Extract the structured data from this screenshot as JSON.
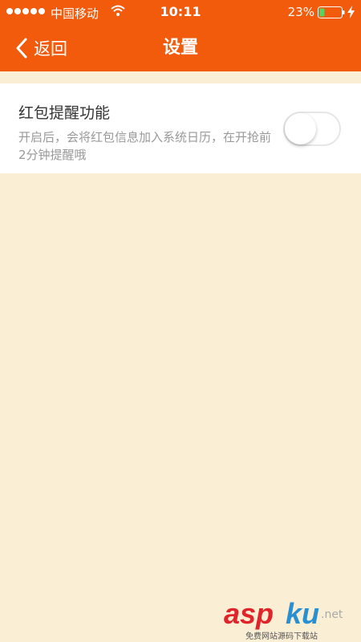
{
  "status_bar": {
    "carrier": "中国移动",
    "time": "10:11",
    "battery_percent": "23%",
    "battery_level": 0.23,
    "icons": [
      "signal-dots-icon",
      "wifi-icon",
      "battery-icon",
      "charging-icon"
    ]
  },
  "nav": {
    "back_label": "返回",
    "title": "设置"
  },
  "setting": {
    "title": "红包提醒功能",
    "description": "开启后，会将红包信息加入系统日历，在开抢前2分钟提醒哦",
    "toggle_on": false
  },
  "watermark": {
    "brand_a": "asp",
    "brand_b": "ku",
    "suffix": ".net",
    "subtitle": "免费网站源码下载站"
  },
  "colors": {
    "header": "#f25a0c",
    "background": "#faefd5",
    "card": "#ffffff",
    "toggle_off_border": "#e6e6e6"
  }
}
